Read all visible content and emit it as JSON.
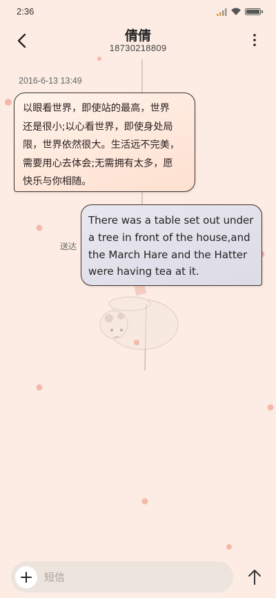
{
  "status_bar": {
    "time": "2:36",
    "icons": [
      "signal-icon",
      "wifi-icon",
      "battery-icon"
    ]
  },
  "header": {
    "contact_name": "倩倩",
    "contact_number": "18730218809",
    "back_icon": "back-arrow-icon",
    "more_icon": "more-vertical-icon"
  },
  "conversation": {
    "timestamp": "2016-6-13 13:49",
    "messages": [
      {
        "direction": "incoming",
        "lines": [
          "以眼看世界，即使站的最高，世界",
          "还是很小;以心看世界，即使身处局",
          "限，世界依然很大。生活远不完美，",
          "需要用心去体会;无需拥有太多，愿",
          "快乐与你相随。"
        ]
      },
      {
        "direction": "outgoing",
        "status": "送达",
        "lines": [
          "There was a table set out under",
          "a tree in front of the house,and",
          "the March Hare and the Hatter",
          "were having tea at it."
        ]
      }
    ]
  },
  "composer": {
    "placeholder": "短信",
    "value": "",
    "add_icon": "plus-icon",
    "send_icon": "send-arrow-icon"
  },
  "colors": {
    "background": "#fcece3",
    "incoming_bubble": "#fde0d0",
    "outgoing_bubble": "#dcdbe6",
    "bubble_border": "#3a3030",
    "input_bar": "#ede4dd"
  }
}
